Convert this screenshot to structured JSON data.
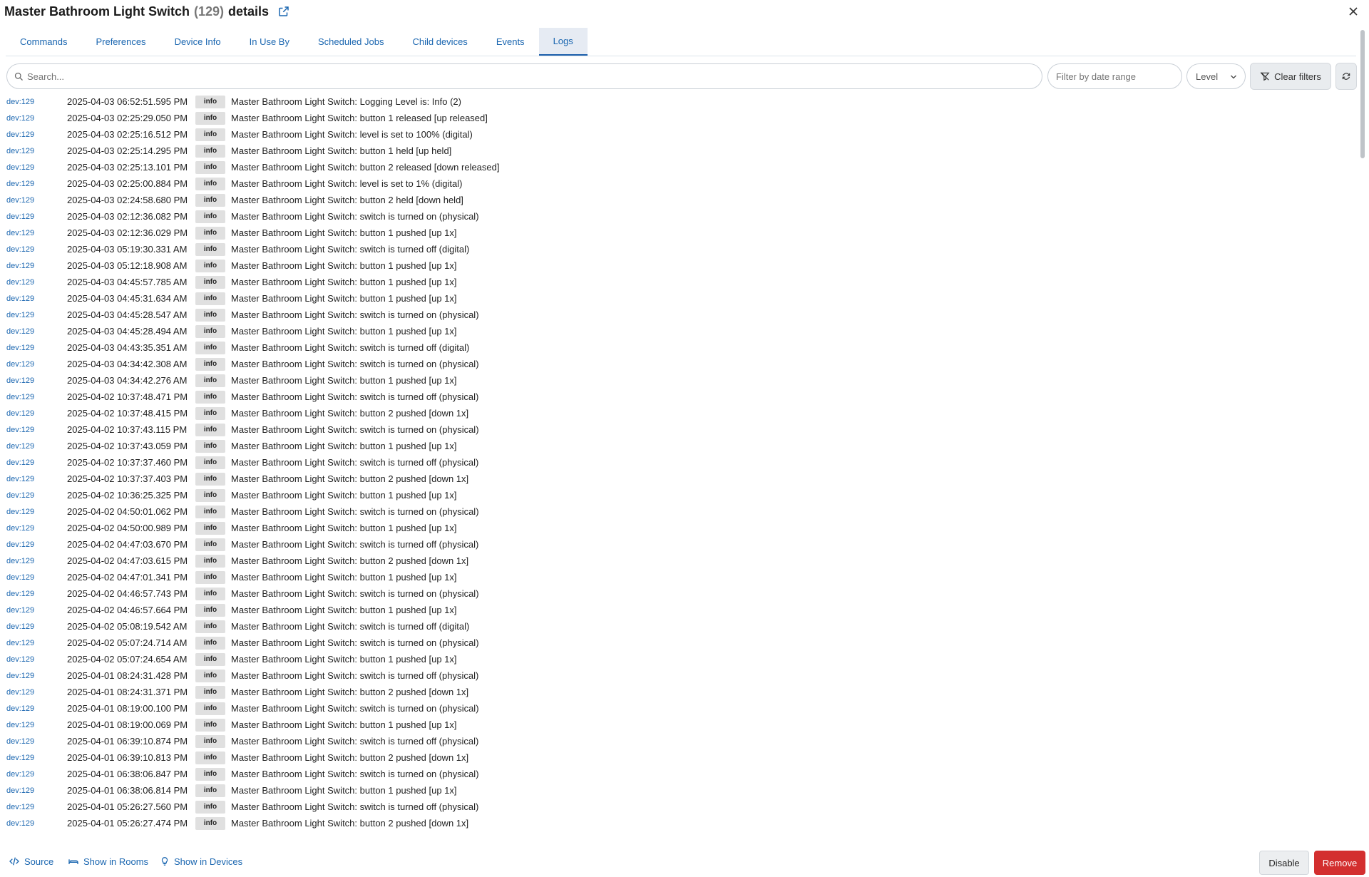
{
  "header": {
    "title": "Master Bathroom Light Switch",
    "device_number": "(129)",
    "suffix": "details"
  },
  "tabs": [
    {
      "label": "Commands"
    },
    {
      "label": "Preferences"
    },
    {
      "label": "Device Info"
    },
    {
      "label": "In Use By"
    },
    {
      "label": "Scheduled Jobs"
    },
    {
      "label": "Child devices"
    },
    {
      "label": "Events"
    },
    {
      "label": "Logs",
      "active": true
    }
  ],
  "filters": {
    "search_placeholder": "Search...",
    "date_placeholder": "Filter by date range",
    "level_label": "Level",
    "clear_label": "Clear filters"
  },
  "logs": [
    {
      "dev": "dev:129",
      "time": "2025-04-03 06:52:51.595 PM",
      "level": "info",
      "msg": "Master Bathroom Light Switch: Logging Level is: Info (2)"
    },
    {
      "dev": "dev:129",
      "time": "2025-04-03 02:25:29.050 PM",
      "level": "info",
      "msg": "Master Bathroom Light Switch: button 1 released [up released]"
    },
    {
      "dev": "dev:129",
      "time": "2025-04-03 02:25:16.512 PM",
      "level": "info",
      "msg": "Master Bathroom Light Switch: level is set to 100% (digital)"
    },
    {
      "dev": "dev:129",
      "time": "2025-04-03 02:25:14.295 PM",
      "level": "info",
      "msg": "Master Bathroom Light Switch: button 1 held [up held]"
    },
    {
      "dev": "dev:129",
      "time": "2025-04-03 02:25:13.101 PM",
      "level": "info",
      "msg": "Master Bathroom Light Switch: button 2 released [down released]"
    },
    {
      "dev": "dev:129",
      "time": "2025-04-03 02:25:00.884 PM",
      "level": "info",
      "msg": "Master Bathroom Light Switch: level is set to 1% (digital)"
    },
    {
      "dev": "dev:129",
      "time": "2025-04-03 02:24:58.680 PM",
      "level": "info",
      "msg": "Master Bathroom Light Switch: button 2 held [down held]"
    },
    {
      "dev": "dev:129",
      "time": "2025-04-03 02:12:36.082 PM",
      "level": "info",
      "msg": "Master Bathroom Light Switch: switch is turned on (physical)"
    },
    {
      "dev": "dev:129",
      "time": "2025-04-03 02:12:36.029 PM",
      "level": "info",
      "msg": "Master Bathroom Light Switch: button 1 pushed [up 1x]"
    },
    {
      "dev": "dev:129",
      "time": "2025-04-03 05:19:30.331 AM",
      "level": "info",
      "msg": "Master Bathroom Light Switch: switch is turned off (digital)"
    },
    {
      "dev": "dev:129",
      "time": "2025-04-03 05:12:18.908 AM",
      "level": "info",
      "msg": "Master Bathroom Light Switch: button 1 pushed [up 1x]"
    },
    {
      "dev": "dev:129",
      "time": "2025-04-03 04:45:57.785 AM",
      "level": "info",
      "msg": "Master Bathroom Light Switch: button 1 pushed [up 1x]"
    },
    {
      "dev": "dev:129",
      "time": "2025-04-03 04:45:31.634 AM",
      "level": "info",
      "msg": "Master Bathroom Light Switch: button 1 pushed [up 1x]"
    },
    {
      "dev": "dev:129",
      "time": "2025-04-03 04:45:28.547 AM",
      "level": "info",
      "msg": "Master Bathroom Light Switch: switch is turned on (physical)"
    },
    {
      "dev": "dev:129",
      "time": "2025-04-03 04:45:28.494 AM",
      "level": "info",
      "msg": "Master Bathroom Light Switch: button 1 pushed [up 1x]"
    },
    {
      "dev": "dev:129",
      "time": "2025-04-03 04:43:35.351 AM",
      "level": "info",
      "msg": "Master Bathroom Light Switch: switch is turned off (digital)"
    },
    {
      "dev": "dev:129",
      "time": "2025-04-03 04:34:42.308 AM",
      "level": "info",
      "msg": "Master Bathroom Light Switch: switch is turned on (physical)"
    },
    {
      "dev": "dev:129",
      "time": "2025-04-03 04:34:42.276 AM",
      "level": "info",
      "msg": "Master Bathroom Light Switch: button 1 pushed [up 1x]"
    },
    {
      "dev": "dev:129",
      "time": "2025-04-02 10:37:48.471 PM",
      "level": "info",
      "msg": "Master Bathroom Light Switch: switch is turned off (physical)"
    },
    {
      "dev": "dev:129",
      "time": "2025-04-02 10:37:48.415 PM",
      "level": "info",
      "msg": "Master Bathroom Light Switch: button 2 pushed [down 1x]"
    },
    {
      "dev": "dev:129",
      "time": "2025-04-02 10:37:43.115 PM",
      "level": "info",
      "msg": "Master Bathroom Light Switch: switch is turned on (physical)"
    },
    {
      "dev": "dev:129",
      "time": "2025-04-02 10:37:43.059 PM",
      "level": "info",
      "msg": "Master Bathroom Light Switch: button 1 pushed [up 1x]"
    },
    {
      "dev": "dev:129",
      "time": "2025-04-02 10:37:37.460 PM",
      "level": "info",
      "msg": "Master Bathroom Light Switch: switch is turned off (physical)"
    },
    {
      "dev": "dev:129",
      "time": "2025-04-02 10:37:37.403 PM",
      "level": "info",
      "msg": "Master Bathroom Light Switch: button 2 pushed [down 1x]"
    },
    {
      "dev": "dev:129",
      "time": "2025-04-02 10:36:25.325 PM",
      "level": "info",
      "msg": "Master Bathroom Light Switch: button 1 pushed [up 1x]"
    },
    {
      "dev": "dev:129",
      "time": "2025-04-02 04:50:01.062 PM",
      "level": "info",
      "msg": "Master Bathroom Light Switch: switch is turned on (physical)"
    },
    {
      "dev": "dev:129",
      "time": "2025-04-02 04:50:00.989 PM",
      "level": "info",
      "msg": "Master Bathroom Light Switch: button 1 pushed [up 1x]"
    },
    {
      "dev": "dev:129",
      "time": "2025-04-02 04:47:03.670 PM",
      "level": "info",
      "msg": "Master Bathroom Light Switch: switch is turned off (physical)"
    },
    {
      "dev": "dev:129",
      "time": "2025-04-02 04:47:03.615 PM",
      "level": "info",
      "msg": "Master Bathroom Light Switch: button 2 pushed [down 1x]"
    },
    {
      "dev": "dev:129",
      "time": "2025-04-02 04:47:01.341 PM",
      "level": "info",
      "msg": "Master Bathroom Light Switch: button 1 pushed [up 1x]"
    },
    {
      "dev": "dev:129",
      "time": "2025-04-02 04:46:57.743 PM",
      "level": "info",
      "msg": "Master Bathroom Light Switch: switch is turned on (physical)"
    },
    {
      "dev": "dev:129",
      "time": "2025-04-02 04:46:57.664 PM",
      "level": "info",
      "msg": "Master Bathroom Light Switch: button 1 pushed [up 1x]"
    },
    {
      "dev": "dev:129",
      "time": "2025-04-02 05:08:19.542 AM",
      "level": "info",
      "msg": "Master Bathroom Light Switch: switch is turned off (digital)"
    },
    {
      "dev": "dev:129",
      "time": "2025-04-02 05:07:24.714 AM",
      "level": "info",
      "msg": "Master Bathroom Light Switch: switch is turned on (physical)"
    },
    {
      "dev": "dev:129",
      "time": "2025-04-02 05:07:24.654 AM",
      "level": "info",
      "msg": "Master Bathroom Light Switch: button 1 pushed [up 1x]"
    },
    {
      "dev": "dev:129",
      "time": "2025-04-01 08:24:31.428 PM",
      "level": "info",
      "msg": "Master Bathroom Light Switch: switch is turned off (physical)"
    },
    {
      "dev": "dev:129",
      "time": "2025-04-01 08:24:31.371 PM",
      "level": "info",
      "msg": "Master Bathroom Light Switch: button 2 pushed [down 1x]"
    },
    {
      "dev": "dev:129",
      "time": "2025-04-01 08:19:00.100 PM",
      "level": "info",
      "msg": "Master Bathroom Light Switch: switch is turned on (physical)"
    },
    {
      "dev": "dev:129",
      "time": "2025-04-01 08:19:00.069 PM",
      "level": "info",
      "msg": "Master Bathroom Light Switch: button 1 pushed [up 1x]"
    },
    {
      "dev": "dev:129",
      "time": "2025-04-01 06:39:10.874 PM",
      "level": "info",
      "msg": "Master Bathroom Light Switch: switch is turned off (physical)"
    },
    {
      "dev": "dev:129",
      "time": "2025-04-01 06:39:10.813 PM",
      "level": "info",
      "msg": "Master Bathroom Light Switch: button 2 pushed [down 1x]"
    },
    {
      "dev": "dev:129",
      "time": "2025-04-01 06:38:06.847 PM",
      "level": "info",
      "msg": "Master Bathroom Light Switch: switch is turned on (physical)"
    },
    {
      "dev": "dev:129",
      "time": "2025-04-01 06:38:06.814 PM",
      "level": "info",
      "msg": "Master Bathroom Light Switch: button 1 pushed [up 1x]"
    },
    {
      "dev": "dev:129",
      "time": "2025-04-01 05:26:27.560 PM",
      "level": "info",
      "msg": "Master Bathroom Light Switch: switch is turned off (physical)"
    },
    {
      "dev": "dev:129",
      "time": "2025-04-01 05:26:27.474 PM",
      "level": "info",
      "msg": "Master Bathroom Light Switch: button 2 pushed [down 1x]"
    }
  ],
  "footer": {
    "source_label": "Source",
    "rooms_label": "Show in Rooms",
    "devices_label": "Show in Devices",
    "disable_label": "Disable",
    "remove_label": "Remove"
  },
  "colors": {
    "accent": "#1a66b0",
    "active_tab_bg": "#e6ebf3",
    "remove": "#d32f2f"
  }
}
